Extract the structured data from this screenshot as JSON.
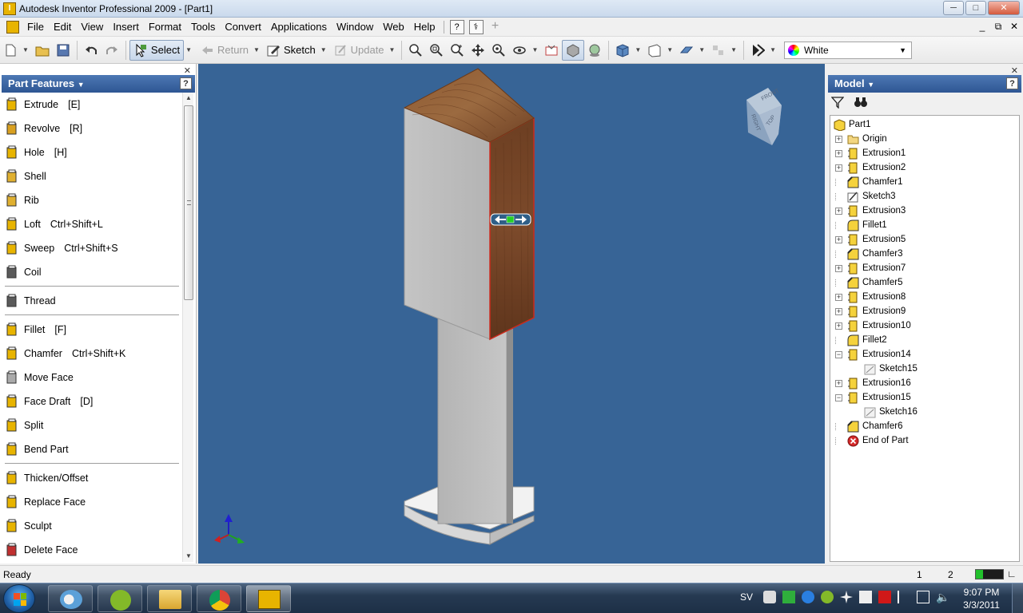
{
  "window": {
    "title": "Autodesk Inventor Professional 2009 - [Part1]",
    "minimize": "─",
    "maximize": "□",
    "close": "✕"
  },
  "menu": {
    "items": [
      "File",
      "Edit",
      "View",
      "Insert",
      "Format",
      "Tools",
      "Convert",
      "Applications",
      "Window",
      "Web",
      "Help"
    ],
    "mdi_minimize": "_",
    "mdi_restore": "⧉",
    "mdi_close": "✕"
  },
  "toolbar": {
    "select": "Select",
    "return": "Return",
    "sketch": "Sketch",
    "update": "Update",
    "color_value": "White"
  },
  "left_panel": {
    "title": "Part Features",
    "help": "?",
    "close": "✕",
    "features": [
      {
        "label": "Extrude",
        "shortcut": "[E]",
        "icon": "extrude-icon"
      },
      {
        "label": "Revolve",
        "shortcut": "[R]",
        "icon": "revolve-icon"
      },
      {
        "label": "Hole",
        "shortcut": "[H]",
        "icon": "hole-icon"
      },
      {
        "label": "Shell",
        "shortcut": "",
        "icon": "shell-icon"
      },
      {
        "label": "Rib",
        "shortcut": "",
        "icon": "rib-icon"
      },
      {
        "label": "Loft",
        "shortcut": "Ctrl+Shift+L",
        "icon": "loft-icon"
      },
      {
        "label": "Sweep",
        "shortcut": "Ctrl+Shift+S",
        "icon": "sweep-icon"
      },
      {
        "label": "Coil",
        "shortcut": "",
        "icon": "coil-icon"
      },
      {
        "label": "Thread",
        "shortcut": "",
        "icon": "thread-icon"
      },
      {
        "label": "Fillet",
        "shortcut": "[F]",
        "icon": "fillet-icon"
      },
      {
        "label": "Chamfer",
        "shortcut": "Ctrl+Shift+K",
        "icon": "chamfer-icon"
      },
      {
        "label": "Move Face",
        "shortcut": "",
        "icon": "move-face-icon"
      },
      {
        "label": "Face Draft",
        "shortcut": "[D]",
        "icon": "face-draft-icon"
      },
      {
        "label": "Split",
        "shortcut": "",
        "icon": "split-icon"
      },
      {
        "label": "Bend Part",
        "shortcut": "",
        "icon": "bend-part-icon"
      },
      {
        "label": "Thicken/Offset",
        "shortcut": "",
        "icon": "thicken-icon"
      },
      {
        "label": "Replace Face",
        "shortcut": "",
        "icon": "replace-face-icon"
      },
      {
        "label": "Sculpt",
        "shortcut": "",
        "icon": "sculpt-icon"
      },
      {
        "label": "Delete Face",
        "shortcut": "",
        "icon": "delete-face-icon"
      }
    ]
  },
  "viewcube": {
    "front": "FRONT",
    "right": "RIGHT",
    "top": "TOP"
  },
  "right_panel": {
    "title": "Model",
    "help": "?",
    "close": "✕",
    "tree": [
      {
        "label": "Part1",
        "type": "part",
        "level": 0,
        "expander": ""
      },
      {
        "label": "Origin",
        "type": "folder",
        "level": 1,
        "expander": "+"
      },
      {
        "label": "Extrusion1",
        "type": "extrusion",
        "level": 1,
        "expander": "+"
      },
      {
        "label": "Extrusion2",
        "type": "extrusion",
        "level": 1,
        "expander": "+"
      },
      {
        "label": "Chamfer1",
        "type": "chamfer",
        "level": 1,
        "expander": ""
      },
      {
        "label": "Sketch3",
        "type": "sketch",
        "level": 1,
        "expander": ""
      },
      {
        "label": "Extrusion3",
        "type": "extrusion",
        "level": 1,
        "expander": "+"
      },
      {
        "label": "Fillet1",
        "type": "fillet",
        "level": 1,
        "expander": ""
      },
      {
        "label": "Extrusion5",
        "type": "extrusion",
        "level": 1,
        "expander": "+"
      },
      {
        "label": "Chamfer3",
        "type": "chamfer",
        "level": 1,
        "expander": ""
      },
      {
        "label": "Extrusion7",
        "type": "extrusion",
        "level": 1,
        "expander": "+"
      },
      {
        "label": "Chamfer5",
        "type": "chamfer",
        "level": 1,
        "expander": ""
      },
      {
        "label": "Extrusion8",
        "type": "extrusion",
        "level": 1,
        "expander": "+"
      },
      {
        "label": "Extrusion9",
        "type": "extrusion",
        "level": 1,
        "expander": "+"
      },
      {
        "label": "Extrusion10",
        "type": "extrusion",
        "level": 1,
        "expander": "+"
      },
      {
        "label": "Fillet2",
        "type": "fillet",
        "level": 1,
        "expander": ""
      },
      {
        "label": "Extrusion14",
        "type": "extrusion",
        "level": 1,
        "expander": "-"
      },
      {
        "label": "Sketch15",
        "type": "sketch-used",
        "level": 2,
        "expander": ""
      },
      {
        "label": "Extrusion16",
        "type": "extrusion",
        "level": 1,
        "expander": "+"
      },
      {
        "label": "Extrusion15",
        "type": "extrusion",
        "level": 1,
        "expander": "-"
      },
      {
        "label": "Sketch16",
        "type": "sketch-used",
        "level": 2,
        "expander": ""
      },
      {
        "label": "Chamfer6",
        "type": "chamfer",
        "level": 1,
        "expander": ""
      },
      {
        "label": "End of Part",
        "type": "end",
        "level": 1,
        "expander": ""
      }
    ]
  },
  "status": {
    "text": "Ready",
    "num1": "1",
    "num2": "2",
    "meter_fraction": 0.25
  },
  "taskbar": {
    "language": "SV",
    "time": "9:07 PM",
    "date": "3/3/2011"
  },
  "colors": {
    "viewport_bg": "#376496",
    "panel_header": "#3a64a0",
    "wood": "#7a4a2c",
    "body_gray": "#c8c8c8",
    "selection_red": "#cc2a1c"
  }
}
